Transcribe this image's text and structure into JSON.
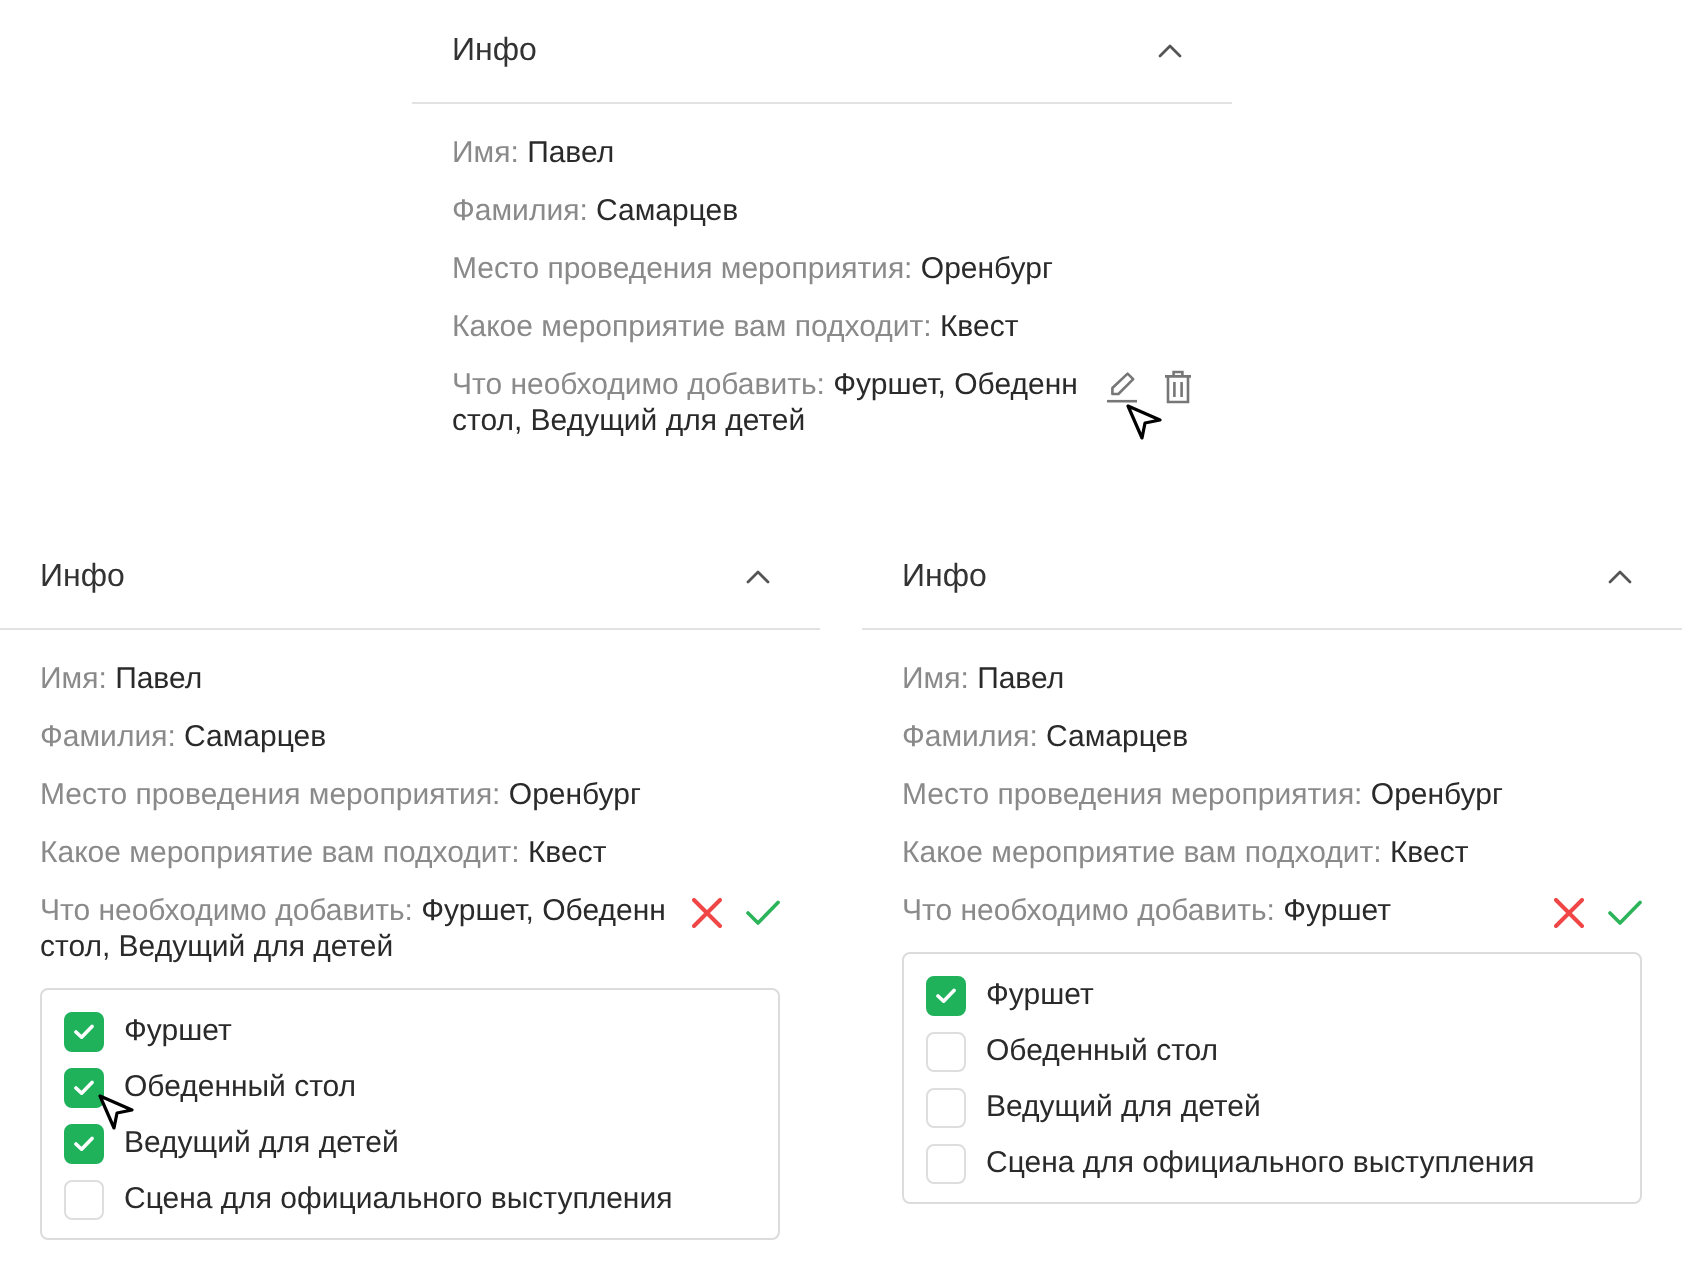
{
  "panels": [
    {
      "title": "Инфо",
      "expanded": true,
      "fields": [
        {
          "label": "Имя:",
          "value": "Павел"
        },
        {
          "label": "Фамилия:",
          "value": "Самарцев"
        },
        {
          "label": "Место проведения мероприятия:",
          "value": "Оренбург"
        },
        {
          "label": "Какое мероприятие вам подходит:",
          "value": "Квест"
        },
        {
          "label": "Что необходимо добавить:",
          "value_lines": [
            "Фуршет, Обеденн",
            "стол, Ведущий для детей"
          ],
          "actions": [
            {
              "kind": "edit",
              "hovered": true
            },
            {
              "kind": "delete",
              "hovered": false
            }
          ]
        }
      ]
    },
    {
      "title": "Инфо",
      "expanded": true,
      "fields": [
        {
          "label": "Имя:",
          "value": "Павел"
        },
        {
          "label": "Фамилия:",
          "value": "Самарцев"
        },
        {
          "label": "Место проведения мероприятия:",
          "value": "Оренбург"
        },
        {
          "label": "Какое мероприятие вам подходит:",
          "value": "Квест"
        },
        {
          "label": "Что необходимо добавить:",
          "value_lines": [
            "Фуршет, Обеденн",
            "стол, Ведущий для детей"
          ],
          "actions": [
            {
              "kind": "cancel",
              "hovered": false
            },
            {
              "kind": "confirm",
              "hovered": false
            }
          ],
          "options": [
            {
              "label": "Фуршет",
              "checked": true,
              "hovered": false
            },
            {
              "label": "Обеденный стол",
              "checked": true,
              "hovered": true
            },
            {
              "label": "Ведущий для детей",
              "checked": true,
              "hovered": false
            },
            {
              "label": "Сцена для официального выступления",
              "checked": false,
              "hovered": false
            }
          ]
        }
      ]
    },
    {
      "title": "Инфо",
      "expanded": true,
      "fields": [
        {
          "label": "Имя:",
          "value": "Павел"
        },
        {
          "label": "Фамилия:",
          "value": "Самарцев"
        },
        {
          "label": "Место проведения мероприятия:",
          "value": "Оренбург"
        },
        {
          "label": "Какое мероприятие вам подходит:",
          "value": "Квест"
        },
        {
          "label": "Что необходимо добавить:",
          "value": "Фуршет",
          "actions": [
            {
              "kind": "cancel",
              "hovered": false
            },
            {
              "kind": "confirm",
              "hovered": false
            }
          ],
          "options": [
            {
              "label": "Фуршет",
              "checked": true,
              "hovered": false
            },
            {
              "label": "Обеденный стол",
              "checked": false,
              "hovered": false
            },
            {
              "label": "Ведущий для детей",
              "checked": false,
              "hovered": false
            },
            {
              "label": "Сцена для официального выступления",
              "checked": false,
              "hovered": false
            }
          ]
        }
      ]
    }
  ]
}
